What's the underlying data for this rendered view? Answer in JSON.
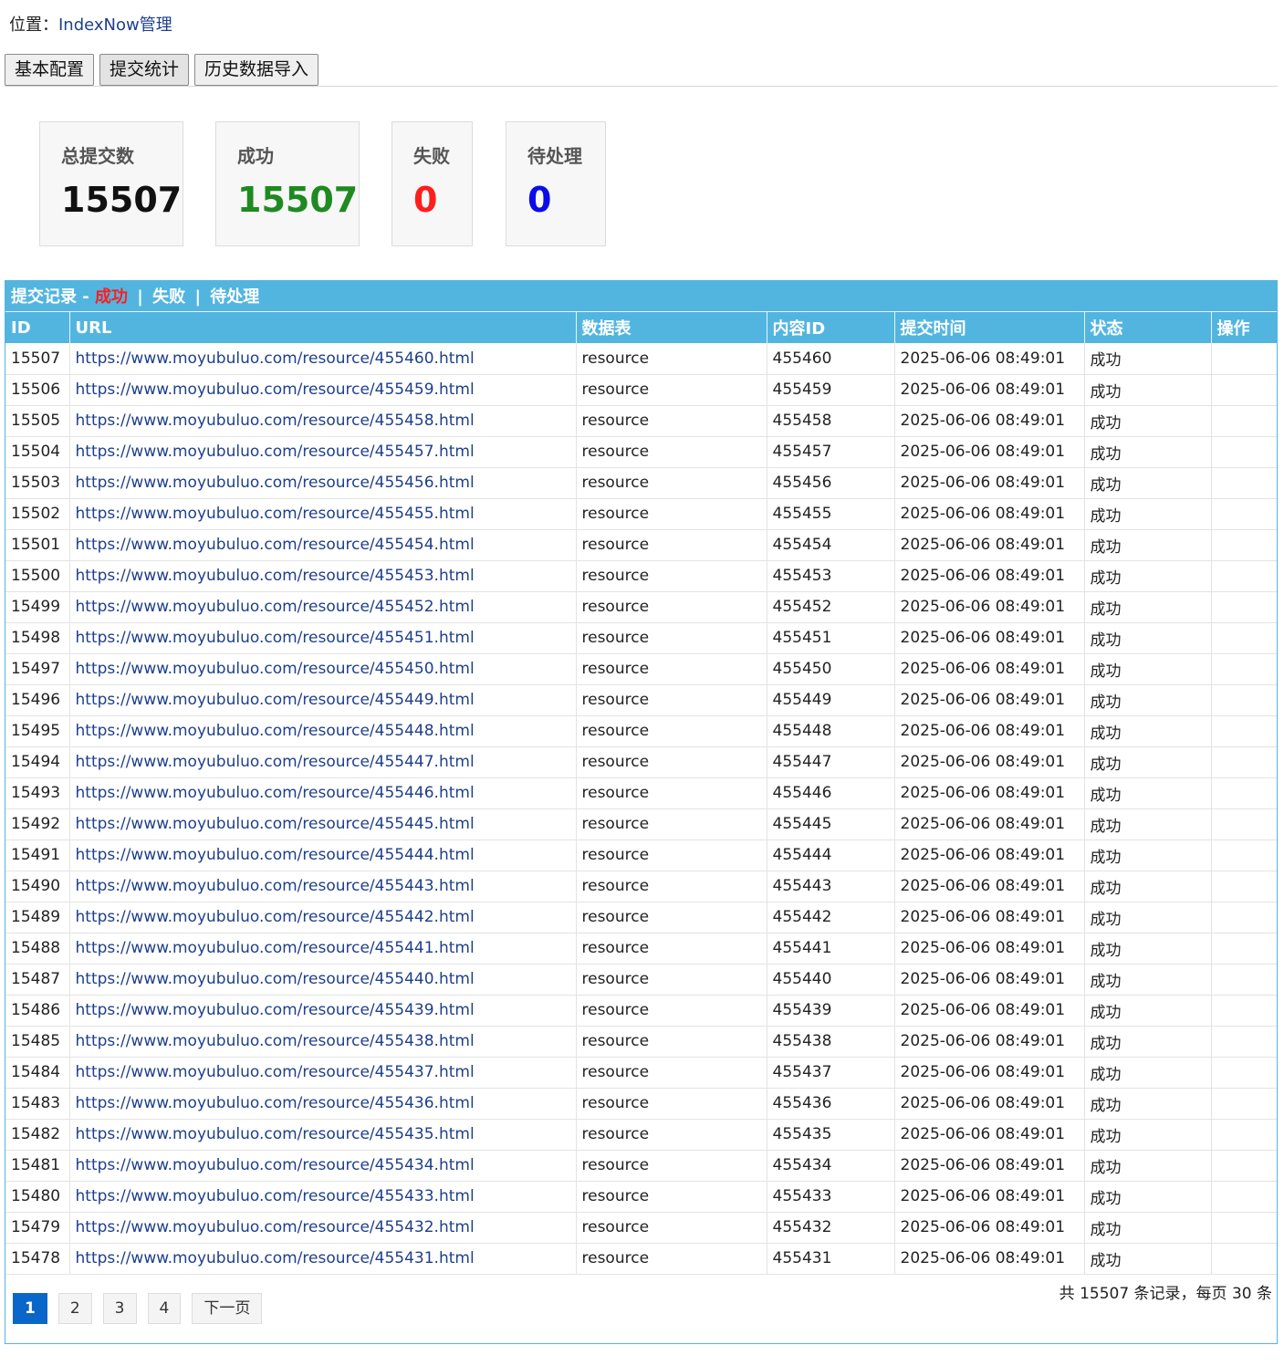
{
  "breadcrumb": {
    "label": "位置：",
    "current": "IndexNow管理"
  },
  "tabs": [
    {
      "label": "基本配置"
    },
    {
      "label": "提交统计"
    },
    {
      "label": "历史数据导入"
    }
  ],
  "stats": [
    {
      "label": "总提交数",
      "value": "15507",
      "color": "#111111"
    },
    {
      "label": "成功",
      "value": "15507",
      "color": "#1f8a1f"
    },
    {
      "label": "失败",
      "value": "0",
      "color": "#ff1e1e"
    },
    {
      "label": "待处理",
      "value": "0",
      "color": "#0b0bea"
    }
  ],
  "panel": {
    "title": "提交记录 - ",
    "filter_success": "成功",
    "separator": "|",
    "filter_failed": "失败",
    "filter_pending": "待处理"
  },
  "table": {
    "columns": [
      "ID",
      "URL",
      "数据表",
      "内容ID",
      "提交时间",
      "状态",
      "操作"
    ],
    "rows": [
      [
        "15507",
        "https://www.moyubuluo.com/resource/455460.html",
        "resource",
        "455460",
        "2025-06-06 08:49:01",
        "成功",
        ""
      ],
      [
        "15506",
        "https://www.moyubuluo.com/resource/455459.html",
        "resource",
        "455459",
        "2025-06-06 08:49:01",
        "成功",
        ""
      ],
      [
        "15505",
        "https://www.moyubuluo.com/resource/455458.html",
        "resource",
        "455458",
        "2025-06-06 08:49:01",
        "成功",
        ""
      ],
      [
        "15504",
        "https://www.moyubuluo.com/resource/455457.html",
        "resource",
        "455457",
        "2025-06-06 08:49:01",
        "成功",
        ""
      ],
      [
        "15503",
        "https://www.moyubuluo.com/resource/455456.html",
        "resource",
        "455456",
        "2025-06-06 08:49:01",
        "成功",
        ""
      ],
      [
        "15502",
        "https://www.moyubuluo.com/resource/455455.html",
        "resource",
        "455455",
        "2025-06-06 08:49:01",
        "成功",
        ""
      ],
      [
        "15501",
        "https://www.moyubuluo.com/resource/455454.html",
        "resource",
        "455454",
        "2025-06-06 08:49:01",
        "成功",
        ""
      ],
      [
        "15500",
        "https://www.moyubuluo.com/resource/455453.html",
        "resource",
        "455453",
        "2025-06-06 08:49:01",
        "成功",
        ""
      ],
      [
        "15499",
        "https://www.moyubuluo.com/resource/455452.html",
        "resource",
        "455452",
        "2025-06-06 08:49:01",
        "成功",
        ""
      ],
      [
        "15498",
        "https://www.moyubuluo.com/resource/455451.html",
        "resource",
        "455451",
        "2025-06-06 08:49:01",
        "成功",
        ""
      ],
      [
        "15497",
        "https://www.moyubuluo.com/resource/455450.html",
        "resource",
        "455450",
        "2025-06-06 08:49:01",
        "成功",
        ""
      ],
      [
        "15496",
        "https://www.moyubuluo.com/resource/455449.html",
        "resource",
        "455449",
        "2025-06-06 08:49:01",
        "成功",
        ""
      ],
      [
        "15495",
        "https://www.moyubuluo.com/resource/455448.html",
        "resource",
        "455448",
        "2025-06-06 08:49:01",
        "成功",
        ""
      ],
      [
        "15494",
        "https://www.moyubuluo.com/resource/455447.html",
        "resource",
        "455447",
        "2025-06-06 08:49:01",
        "成功",
        ""
      ],
      [
        "15493",
        "https://www.moyubuluo.com/resource/455446.html",
        "resource",
        "455446",
        "2025-06-06 08:49:01",
        "成功",
        ""
      ],
      [
        "15492",
        "https://www.moyubuluo.com/resource/455445.html",
        "resource",
        "455445",
        "2025-06-06 08:49:01",
        "成功",
        ""
      ],
      [
        "15491",
        "https://www.moyubuluo.com/resource/455444.html",
        "resource",
        "455444",
        "2025-06-06 08:49:01",
        "成功",
        ""
      ],
      [
        "15490",
        "https://www.moyubuluo.com/resource/455443.html",
        "resource",
        "455443",
        "2025-06-06 08:49:01",
        "成功",
        ""
      ],
      [
        "15489",
        "https://www.moyubuluo.com/resource/455442.html",
        "resource",
        "455442",
        "2025-06-06 08:49:01",
        "成功",
        ""
      ],
      [
        "15488",
        "https://www.moyubuluo.com/resource/455441.html",
        "resource",
        "455441",
        "2025-06-06 08:49:01",
        "成功",
        ""
      ],
      [
        "15487",
        "https://www.moyubuluo.com/resource/455440.html",
        "resource",
        "455440",
        "2025-06-06 08:49:01",
        "成功",
        ""
      ],
      [
        "15486",
        "https://www.moyubuluo.com/resource/455439.html",
        "resource",
        "455439",
        "2025-06-06 08:49:01",
        "成功",
        ""
      ],
      [
        "15485",
        "https://www.moyubuluo.com/resource/455438.html",
        "resource",
        "455438",
        "2025-06-06 08:49:01",
        "成功",
        ""
      ],
      [
        "15484",
        "https://www.moyubuluo.com/resource/455437.html",
        "resource",
        "455437",
        "2025-06-06 08:49:01",
        "成功",
        ""
      ],
      [
        "15483",
        "https://www.moyubuluo.com/resource/455436.html",
        "resource",
        "455436",
        "2025-06-06 08:49:01",
        "成功",
        ""
      ],
      [
        "15482",
        "https://www.moyubuluo.com/resource/455435.html",
        "resource",
        "455435",
        "2025-06-06 08:49:01",
        "成功",
        ""
      ],
      [
        "15481",
        "https://www.moyubuluo.com/resource/455434.html",
        "resource",
        "455434",
        "2025-06-06 08:49:01",
        "成功",
        ""
      ],
      [
        "15480",
        "https://www.moyubuluo.com/resource/455433.html",
        "resource",
        "455433",
        "2025-06-06 08:49:01",
        "成功",
        ""
      ],
      [
        "15479",
        "https://www.moyubuluo.com/resource/455432.html",
        "resource",
        "455432",
        "2025-06-06 08:49:01",
        "成功",
        ""
      ],
      [
        "15478",
        "https://www.moyubuluo.com/resource/455431.html",
        "resource",
        "455431",
        "2025-06-06 08:49:01",
        "成功",
        ""
      ]
    ]
  },
  "pagination": {
    "pages": [
      "1",
      "2",
      "3",
      "4"
    ],
    "current": "1",
    "next_label": "下一页",
    "summary": "共 15507 条记录，每页 30 条"
  },
  "colors": {
    "panel_header": "#52b5e0",
    "link": "#1e3f8a",
    "success": "#1f8a1f",
    "failed": "#ff1e1e",
    "pending": "#0b0bea",
    "current_page": "#0a66c8"
  }
}
